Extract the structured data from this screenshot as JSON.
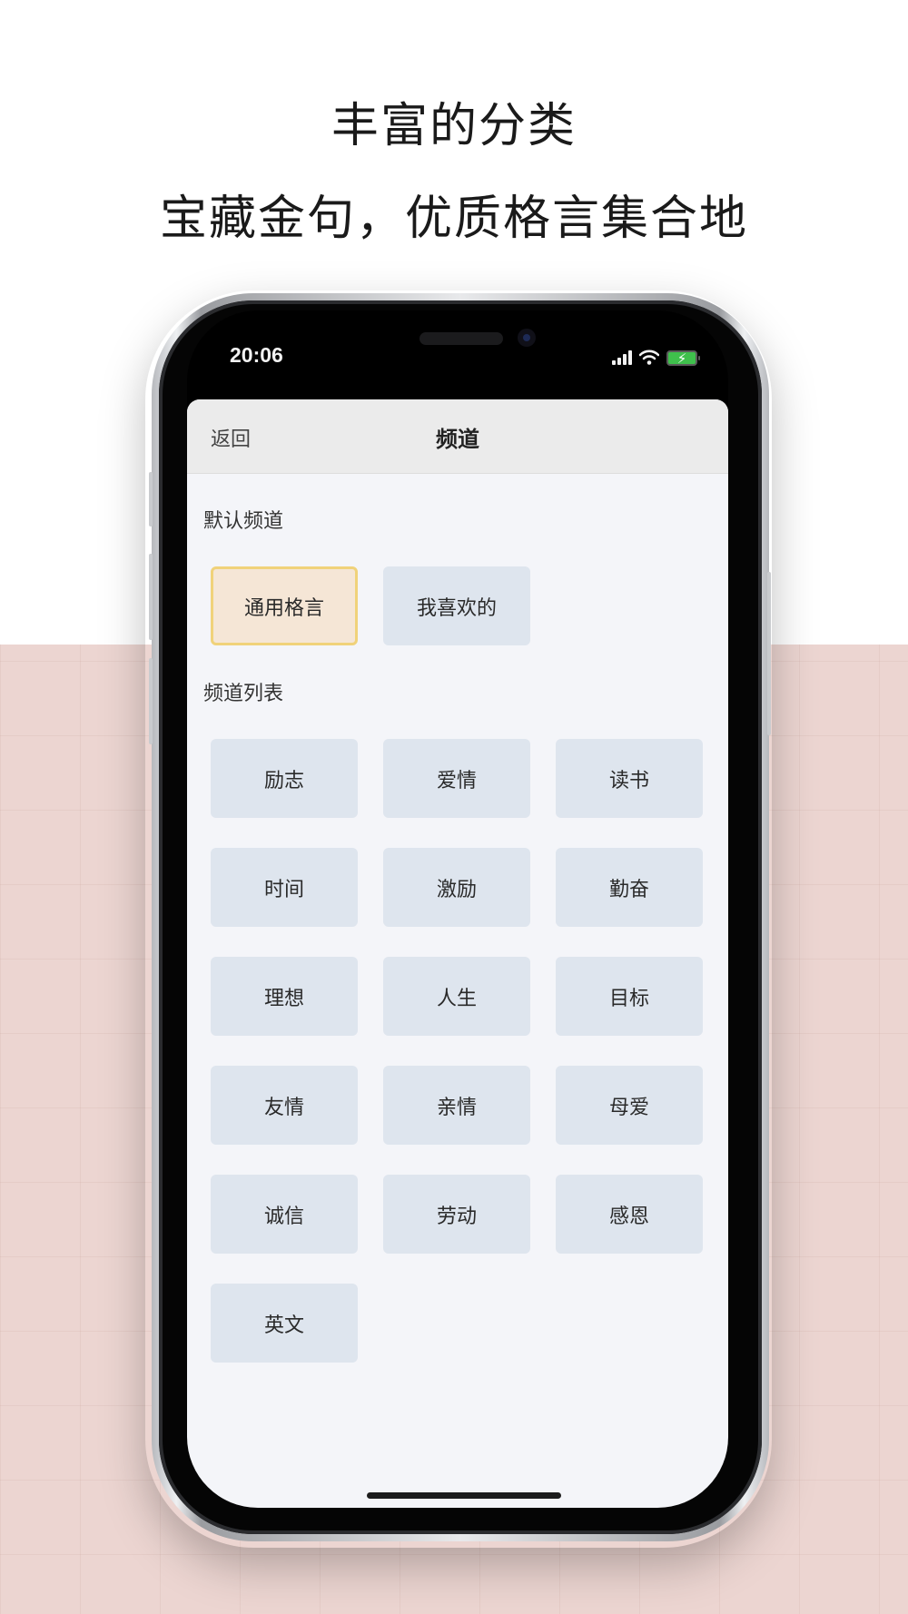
{
  "promo": {
    "headline": "丰富的分类",
    "subline": "宝藏金句，优质格言集合地",
    "accent_color": "#ecd3cf",
    "background_bottom_color": "#ecd5d1"
  },
  "status_bar": {
    "time": "20:06",
    "icons": [
      "signal-icon",
      "wifi-icon",
      "battery-charging-icon"
    ]
  },
  "nav": {
    "back_label": "返回",
    "title": "频道"
  },
  "default_channels": {
    "title": "默认频道",
    "items": [
      {
        "label": "通用格言",
        "selected": true
      },
      {
        "label": "我喜欢的",
        "selected": false
      }
    ]
  },
  "channel_list": {
    "title": "频道列表",
    "items": [
      {
        "label": "励志"
      },
      {
        "label": "爱情"
      },
      {
        "label": "读书"
      },
      {
        "label": "时间"
      },
      {
        "label": "激励"
      },
      {
        "label": "勤奋"
      },
      {
        "label": "理想"
      },
      {
        "label": "人生"
      },
      {
        "label": "目标"
      },
      {
        "label": "友情"
      },
      {
        "label": "亲情"
      },
      {
        "label": "母爱"
      },
      {
        "label": "诚信"
      },
      {
        "label": "劳动"
      },
      {
        "label": "感恩"
      },
      {
        "label": "英文"
      }
    ]
  },
  "colors": {
    "chip_bg": "#dee5ee",
    "chip_selected_bg": "#f5e6d6",
    "chip_selected_border": "#f0d27a",
    "battery_green": "#3fc04c"
  }
}
